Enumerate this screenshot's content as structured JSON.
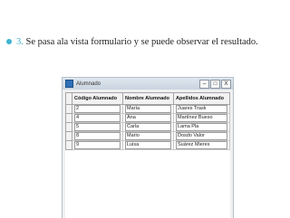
{
  "bullet": {
    "step": "3.",
    "text": "Se pasa ala vista formulario y se puede observar el resultado."
  },
  "window": {
    "title": "Alumnado",
    "buttons": {
      "minimize": "–",
      "maximize": "□",
      "close": "X"
    },
    "columns": [
      "Código Alumnado",
      "Nombre Alumnado",
      "Apellidos Alumnado"
    ],
    "rows": [
      [
        "2",
        "María",
        "Juares Trask"
      ],
      [
        "4",
        "Ana",
        "Martínez Bueso"
      ],
      [
        "5",
        "Carla",
        "Lama Pla"
      ],
      [
        "8",
        "Mario",
        "Dosdo Valor"
      ],
      [
        "9",
        "Luisa",
        "Suárez Mieres"
      ]
    ]
  },
  "colors": {
    "accent": "#40b3cf",
    "titlebar": "#c9d4df"
  }
}
